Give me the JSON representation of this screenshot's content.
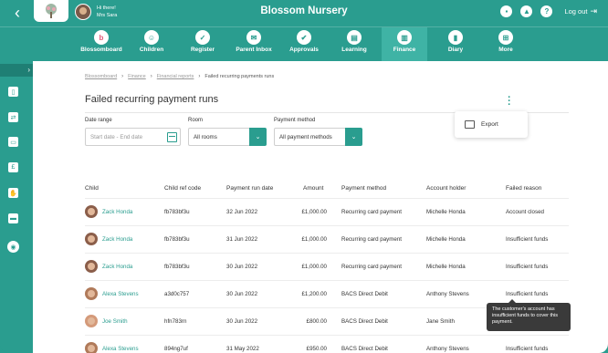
{
  "header": {
    "title": "Blossom Nursery",
    "greeting": "Hi there!",
    "user_name": "Mrs Sara",
    "logout_label": "Log out"
  },
  "nav": {
    "items": [
      {
        "label": "Blossomboard",
        "icon": "blossom-logo-icon"
      },
      {
        "label": "Children",
        "icon": "child-face-icon"
      },
      {
        "label": "Register",
        "icon": "register-icon"
      },
      {
        "label": "Parent Inbox",
        "icon": "inbox-icon"
      },
      {
        "label": "Approvals",
        "icon": "clipboard-check-icon"
      },
      {
        "label": "Learning",
        "icon": "book-icon"
      },
      {
        "label": "Finance",
        "icon": "chart-icon",
        "active": true
      },
      {
        "label": "Diary",
        "icon": "diary-icon"
      },
      {
        "label": "More",
        "icon": "grid-icon"
      }
    ]
  },
  "breadcrumb": {
    "items": [
      "Blossomboard",
      "Finance",
      "Financial reports"
    ],
    "current": "Failed recurring payments runs"
  },
  "page": {
    "title": "Failed recurring payment runs",
    "export_label": "Export"
  },
  "filters": {
    "date_range_label": "Date range",
    "date_range_placeholder": "Start date - End date",
    "room_label": "Room",
    "room_value": "All rooms",
    "payment_method_label": "Payment method",
    "payment_method_value": "All payment methods"
  },
  "table": {
    "headers": [
      "Child",
      "Child ref code",
      "Payment run date",
      "Amount",
      "Payment method",
      "Account holder",
      "Failed reason"
    ],
    "rows": [
      {
        "child": "Zack Honda",
        "ref": "fb783bf3u",
        "date": "32 Jun 2022",
        "amount": "£1,000.00",
        "method": "Recurring card payment",
        "holder": "Michelle Honda",
        "reason": "Account closed"
      },
      {
        "child": "Zack Honda",
        "ref": "fb783bf3u",
        "date": "31 Jun 2022",
        "amount": "£1,000.00",
        "method": "Recurring card payment",
        "holder": "Michelle Honda",
        "reason": "Insufficient funds"
      },
      {
        "child": "Zack Honda",
        "ref": "fb783bf3u",
        "date": "30 Jun 2022",
        "amount": "£1,000.00",
        "method": "Recurring card payment",
        "holder": "Michelle Honda",
        "reason": "Insufficient funds"
      },
      {
        "child": "Alexa Stevens",
        "ref": "a3d0c757",
        "date": "30 Jun 2022",
        "amount": "£1,200.00",
        "method": "BACS Direct Debit",
        "holder": "Anthony Stevens",
        "reason": "Insufficient funds"
      },
      {
        "child": "Joe Smith",
        "ref": "hfn783rn",
        "date": "30 Jun 2022",
        "amount": "£800.00",
        "method": "BACS Direct Debit",
        "holder": "Jane Smith",
        "reason": ""
      },
      {
        "child": "Alexa Stevens",
        "ref": "894ng7uf",
        "date": "31 May 2022",
        "amount": "£950.00",
        "method": "BACS Direct Debit",
        "holder": "Anthony Stevens",
        "reason": "Insufficient funds"
      }
    ]
  },
  "tooltip": {
    "text": "The customer's account has insufficient funds to cover this payment."
  },
  "colors": {
    "brand": "#2a9d8f",
    "link": "#2a9d8f"
  }
}
